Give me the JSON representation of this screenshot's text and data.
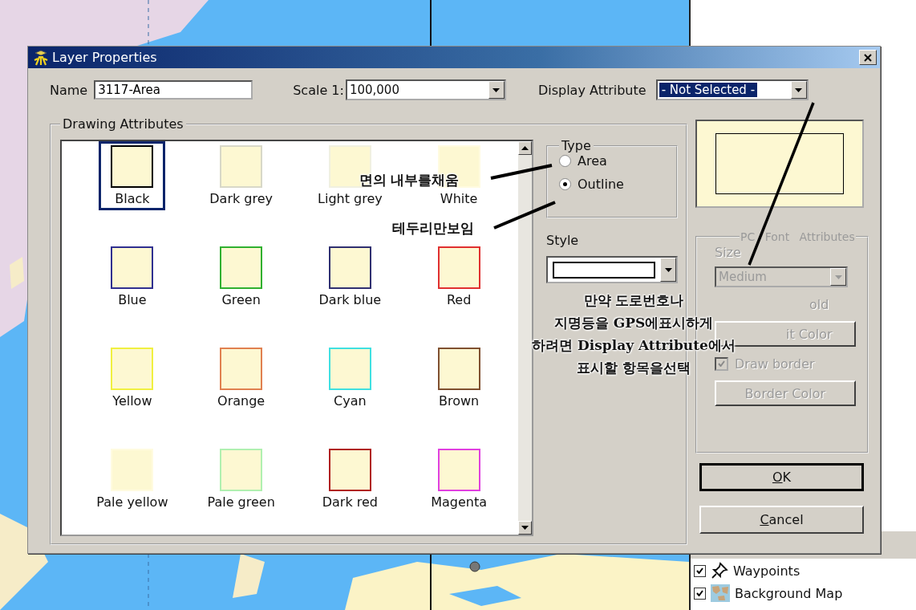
{
  "dialog": {
    "title": "Layer Properties",
    "name": {
      "label": "Name",
      "value": "3117-Area"
    },
    "scale": {
      "label": "Scale 1:",
      "value": "100,000"
    },
    "display_attribute": {
      "label": "Display Attribute",
      "value": "- Not Selected -"
    },
    "drawing_attributes": {
      "title": "Drawing Attributes",
      "swatches": [
        {
          "label": "Black",
          "color": "#000000",
          "selected": true
        },
        {
          "label": "Dark grey",
          "color": "#d8d8c8",
          "selected": false
        },
        {
          "label": "Light grey",
          "color": "#f0f0e0",
          "selected": false
        },
        {
          "label": "White",
          "color": "#fffbe0",
          "selected": false
        },
        {
          "label": "Blue",
          "color": "#303090",
          "selected": false
        },
        {
          "label": "Green",
          "color": "#30b030",
          "selected": false
        },
        {
          "label": "Dark blue",
          "color": "#303070",
          "selected": false
        },
        {
          "label": "Red",
          "color": "#e03030",
          "selected": false
        },
        {
          "label": "Yellow",
          "color": "#f0f040",
          "selected": false
        },
        {
          "label": "Orange",
          "color": "#e08050",
          "selected": false
        },
        {
          "label": "Cyan",
          "color": "#40e0e0",
          "selected": false
        },
        {
          "label": "Brown",
          "color": "#805030",
          "selected": false
        },
        {
          "label": "Pale yellow",
          "color": "#fffbe0",
          "selected": false
        },
        {
          "label": "Pale green",
          "color": "#b0f0b0",
          "selected": false
        },
        {
          "label": "Dark red",
          "color": "#b02020",
          "selected": false
        },
        {
          "label": "Magenta",
          "color": "#e040e0",
          "selected": false
        }
      ]
    },
    "type": {
      "title": "Type",
      "options": [
        {
          "label": "Area",
          "selected": false
        },
        {
          "label": "Outline",
          "selected": true
        }
      ]
    },
    "style": {
      "label": "Style"
    },
    "font_attributes": {
      "title": "PC Font Attributes",
      "disabled": true,
      "size_label": "Size",
      "size_value": "Medium",
      "bold_label": "old",
      "font_color_button": "it Color",
      "draw_border": {
        "label": "Draw border",
        "checked": true
      },
      "border_color_button": "Border Color"
    },
    "buttons": [
      {
        "label": "OK",
        "default": true
      },
      {
        "label": "Cancel",
        "default": false
      }
    ]
  },
  "annotations": [
    {
      "lines": [
        "면의 내부를채움"
      ]
    },
    {
      "lines": [
        "테두리만보임"
      ]
    },
    {
      "lines": [
        "만약 도로번호나",
        "지명등을 GPS에표시하게",
        "하려면 Display Attribute에서",
        "표시할 항목을선택"
      ]
    }
  ],
  "layers": [
    {
      "label": "Waypoints",
      "checked": true
    },
    {
      "label": "Background Map",
      "checked": true
    }
  ]
}
